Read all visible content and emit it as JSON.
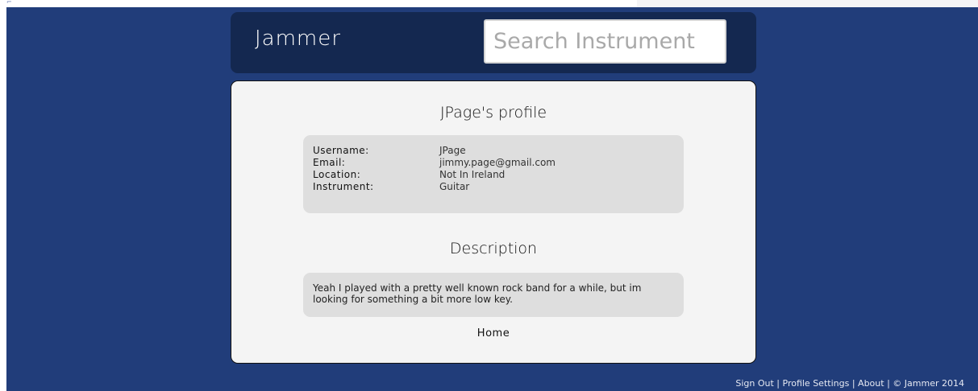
{
  "header": {
    "brand": "Jammer",
    "search_placeholder": "Search Instrument"
  },
  "profile": {
    "title": "JPage's profile",
    "fields": [
      {
        "label": "Username:",
        "value": "JPage"
      },
      {
        "label": "Email:",
        "value": "jimmy.page@gmail.com"
      },
      {
        "label": "Location:",
        "value": "Not In Ireland"
      },
      {
        "label": "Instrument:",
        "value": "Guitar"
      }
    ]
  },
  "description": {
    "title": "Description",
    "text": "Yeah I played with a pretty well known rock band for a while, but im looking for something a bit more low key."
  },
  "home_link": "Home",
  "footer": {
    "sign_out": "Sign Out",
    "separator": "|",
    "profile_settings": "Profile Settings",
    "about": "About",
    "copyright": "© Jammer 2014"
  },
  "colors": {
    "page_background": "#213d7a",
    "header_background": "#142850",
    "card_background": "#f4f4f4",
    "info_box_background": "#dedede"
  }
}
